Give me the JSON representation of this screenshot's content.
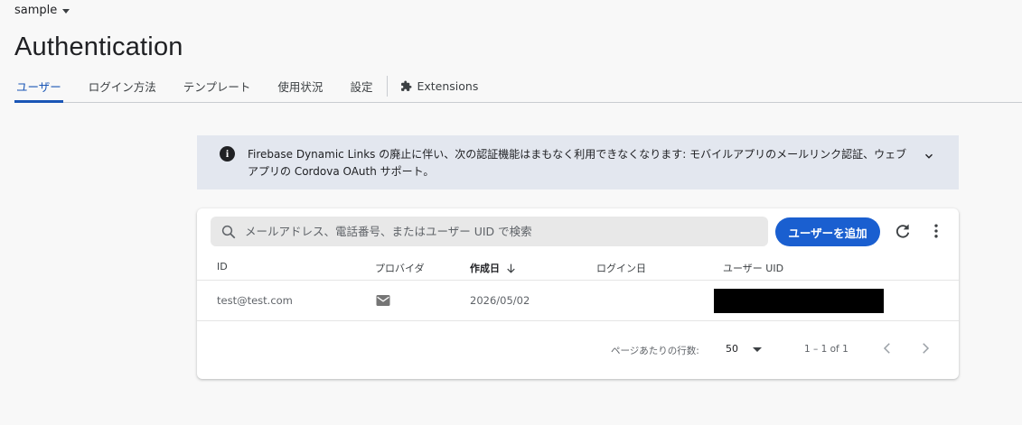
{
  "project": {
    "name": "sample"
  },
  "page_title": "Authentication",
  "tabs": [
    {
      "label": "ユーザー",
      "active": true
    },
    {
      "label": "ログイン方法"
    },
    {
      "label": "テンプレート"
    },
    {
      "label": "使用状況"
    },
    {
      "label": "設定"
    },
    {
      "label": "Extensions",
      "icon": "extensions-icon"
    }
  ],
  "banner": {
    "text": "Firebase Dynamic Links の廃止に伴い、次の認証機能はまもなく利用できなくなります: モバイルアプリのメールリンク認証、ウェブアプリの Cordova OAuth サポート。",
    "icon": "info-icon"
  },
  "search": {
    "placeholder": "メールアドレス、電話番号、またはユーザー UID で検索",
    "value": ""
  },
  "add_user_label": "ユーザーを追加",
  "table": {
    "columns": [
      "ID",
      "プロバイダ",
      "作成日",
      "ログイン日",
      "ユーザー UID"
    ],
    "sorted_column": "作成日",
    "rows": [
      {
        "id": "test@test.com",
        "provider": "email",
        "created": "2026/05/02",
        "last_login": "",
        "uid": ""
      }
    ]
  },
  "pagination": {
    "rows_per_page_label": "ページあたりの行数:",
    "rows_per_page": "50",
    "range": "1 – 1 of 1"
  },
  "colors": {
    "accent": "#1a56b6",
    "button": "#1a5fd0",
    "banner_bg": "#e3e7ef"
  }
}
